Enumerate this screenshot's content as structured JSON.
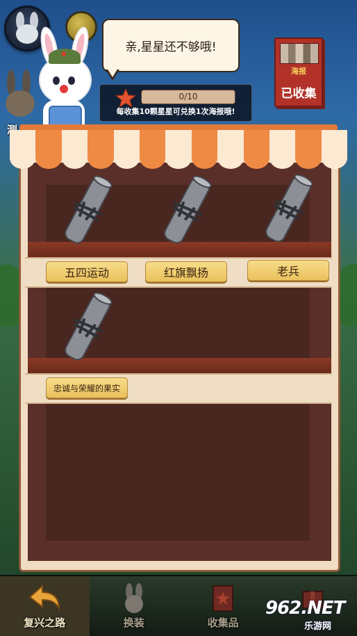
{
  "mascot": {
    "speech": "亲,星星还不够哦!"
  },
  "star_progress": {
    "text": "0/10",
    "current": 0,
    "total": 10,
    "hint": "每收集10颗星星可兑换1次海报哦!"
  },
  "poster": {
    "title": "海报",
    "status": "已收集"
  },
  "side": {
    "label": "测"
  },
  "shelves": [
    {
      "items": [
        "五四运动",
        "红旗飘扬",
        "老兵"
      ]
    },
    {
      "items": [
        "忠诚与荣耀的果实"
      ]
    }
  ],
  "bottom_nav": [
    {
      "label": "复兴之路",
      "icon": "back-arrow-icon",
      "active": true
    },
    {
      "label": "换装",
      "icon": "rabbit-icon",
      "active": false
    },
    {
      "label": "收集品",
      "icon": "collection-icon",
      "active": false
    },
    {
      "label": "",
      "icon": "gift-icon",
      "active": false
    }
  ],
  "watermark": {
    "main": "962.NET",
    "sub": "乐游网"
  },
  "colors": {
    "awning_orange": "#ef8a45",
    "awning_cream": "#fbe9d2",
    "label_gold": "#eac15c",
    "shelf_dark": "#5b2f29"
  }
}
